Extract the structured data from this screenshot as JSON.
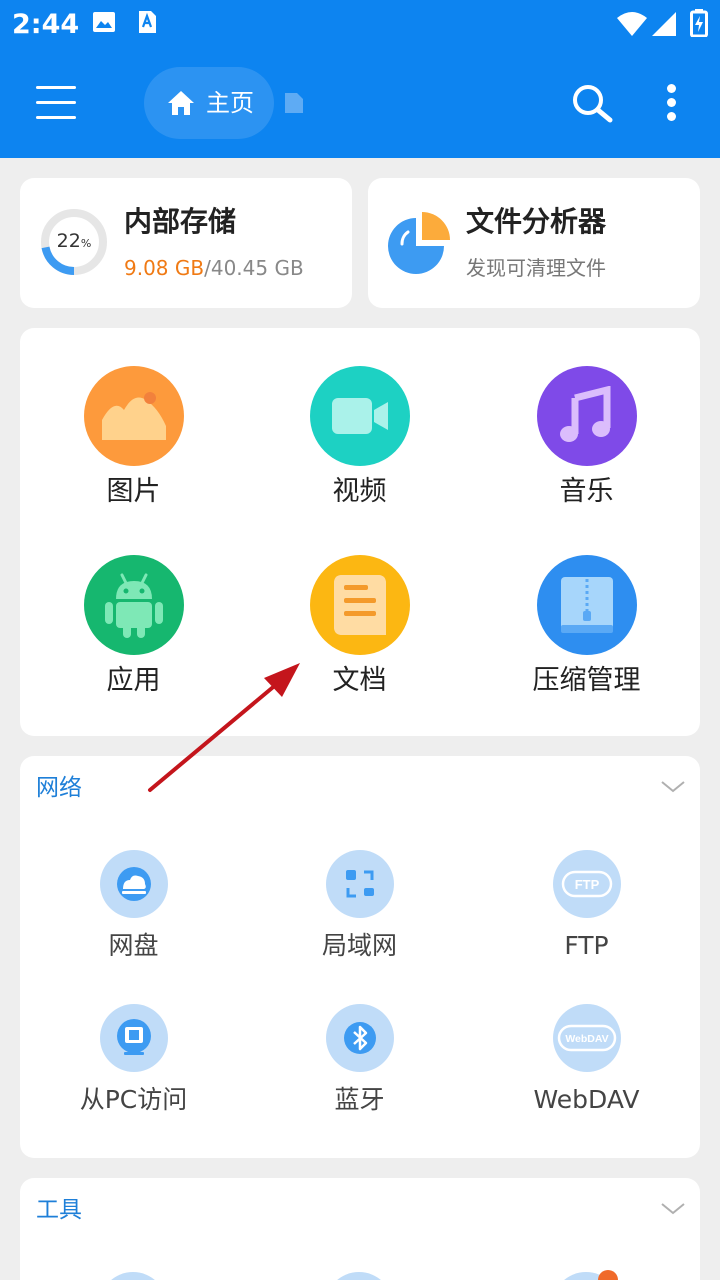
{
  "status_bar": {
    "time": "2:44"
  },
  "app_bar": {
    "home_tab_label": "主页"
  },
  "storage_card": {
    "percent": "22",
    "percent_unit": "%",
    "title": "内部存储",
    "used": "9.08 GB",
    "total": "/40.45 GB",
    "used_fraction": 0.22
  },
  "analyzer_card": {
    "title": "文件分析器",
    "subtitle": "发现可清理文件"
  },
  "categories": [
    {
      "label": "图片",
      "icon": "image-icon",
      "color": "#fd9a3c"
    },
    {
      "label": "视频",
      "icon": "video-icon",
      "color": "#1dd1c3"
    },
    {
      "label": "音乐",
      "icon": "music-icon",
      "color": "#7f4ae8"
    },
    {
      "label": "应用",
      "icon": "android-icon",
      "color": "#16b76f"
    },
    {
      "label": "文档",
      "icon": "document-icon",
      "color": "#fcb712"
    },
    {
      "label": "压缩管理",
      "icon": "archive-icon",
      "color": "#2e8ef0"
    }
  ],
  "network": {
    "title": "网络",
    "items": [
      {
        "label": "网盘",
        "icon": "cloud-icon"
      },
      {
        "label": "局域网",
        "icon": "lan-icon"
      },
      {
        "label": "FTP",
        "icon": "ftp-icon",
        "icon_text": "FTP"
      },
      {
        "label": "从PC访问",
        "icon": "monitor-icon"
      },
      {
        "label": "蓝牙",
        "icon": "bluetooth-icon"
      },
      {
        "label": "WebDAV",
        "icon": "webdav-icon",
        "icon_text": "WebDAV"
      }
    ]
  },
  "tools": {
    "title": "工具"
  },
  "colors": {
    "primary": "#0d84f0",
    "accent_orange": "#f07a14",
    "section_blue": "#1e7fd8",
    "annotation_arrow": "#c4151c"
  }
}
